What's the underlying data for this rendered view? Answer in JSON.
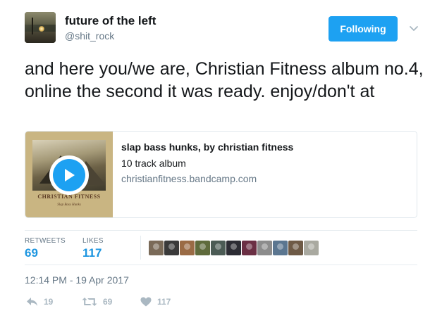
{
  "author": {
    "name": "future of the left",
    "handle": "@shit_rock"
  },
  "follow_button": {
    "label": "Following"
  },
  "tweet": {
    "text": "and here you/we are, Christian Fitness album no.4, online the second it was ready. enjoy/don't at"
  },
  "card": {
    "title": "slap bass hunks, by christian fitness",
    "description": "10 track album",
    "domain": "christianfitness.bandcamp.com",
    "thumbnail_title": "CHRISTIAN FITNESS",
    "thumbnail_subtitle": "Slap Bass Hunks"
  },
  "stats": {
    "retweets_label": "RETWEETS",
    "retweets_value": "69",
    "likes_label": "LIKES",
    "likes_value": "117"
  },
  "likers": [
    {
      "color": "#7a6a58"
    },
    {
      "color": "#3a3a3a"
    },
    {
      "color": "#9a6b45"
    },
    {
      "color": "#5f6b3c"
    },
    {
      "color": "#4b5b55"
    },
    {
      "color": "#2c2c34"
    },
    {
      "color": "#6b2f44"
    },
    {
      "color": "#8c8c8c"
    },
    {
      "color": "#5b7690"
    },
    {
      "color": "#6e5a46"
    },
    {
      "color": "#a9a9a0"
    }
  ],
  "timestamp": "12:14 PM - 19 Apr 2017",
  "actions": {
    "reply_count": "19",
    "retweet_count": "69",
    "like_count": "117"
  },
  "colors": {
    "accent": "#1da1f2",
    "link": "#1b95e0",
    "muted": "#657786",
    "icon_muted": "#aab8c2"
  },
  "icons": {
    "chevron": "chevron-down-icon",
    "play": "play-icon",
    "reply": "reply-icon",
    "retweet": "retweet-icon",
    "like": "heart-icon"
  }
}
